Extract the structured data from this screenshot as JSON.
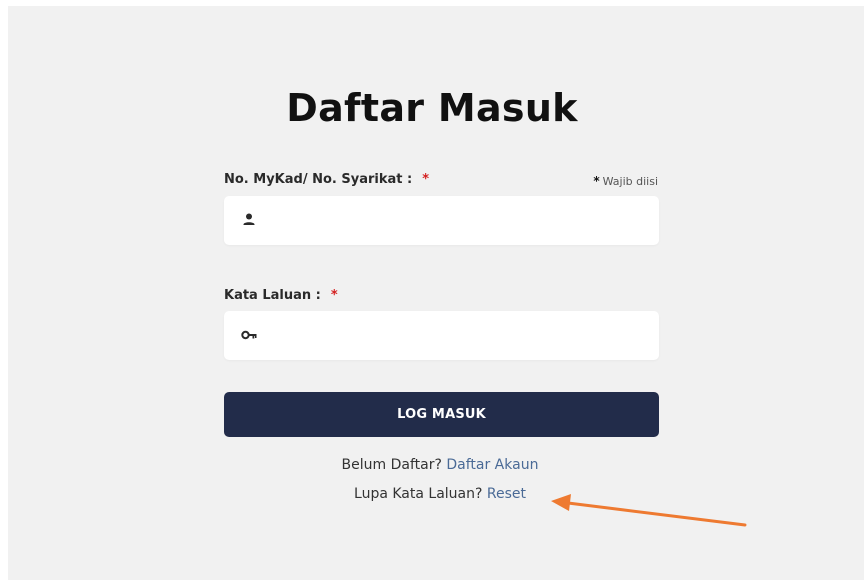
{
  "login": {
    "title": "Daftar Masuk",
    "id_label": "No. MyKad/ No. Syarikat :",
    "required_mark": "*",
    "required_note_star": "*",
    "required_note": "Wajib diisi",
    "id_value": "",
    "password_label": "Kata Laluan :",
    "password_value": "",
    "submit_label": "LOG MASUK",
    "register_prompt": "Belum Daftar?",
    "register_link": "Daftar Akaun",
    "forgot_prompt": "Lupa Kata Laluan?",
    "forgot_link": "Reset"
  },
  "icons": {
    "id_field": "user-icon",
    "password_field": "key-icon",
    "annotation": "arrow-icon"
  },
  "colors": {
    "panel_bg": "#f1f1f1",
    "button_bg": "#222c4a",
    "link": "#4a6a96",
    "required": "#d42020",
    "annotation_arrow": "#ee7a31"
  }
}
